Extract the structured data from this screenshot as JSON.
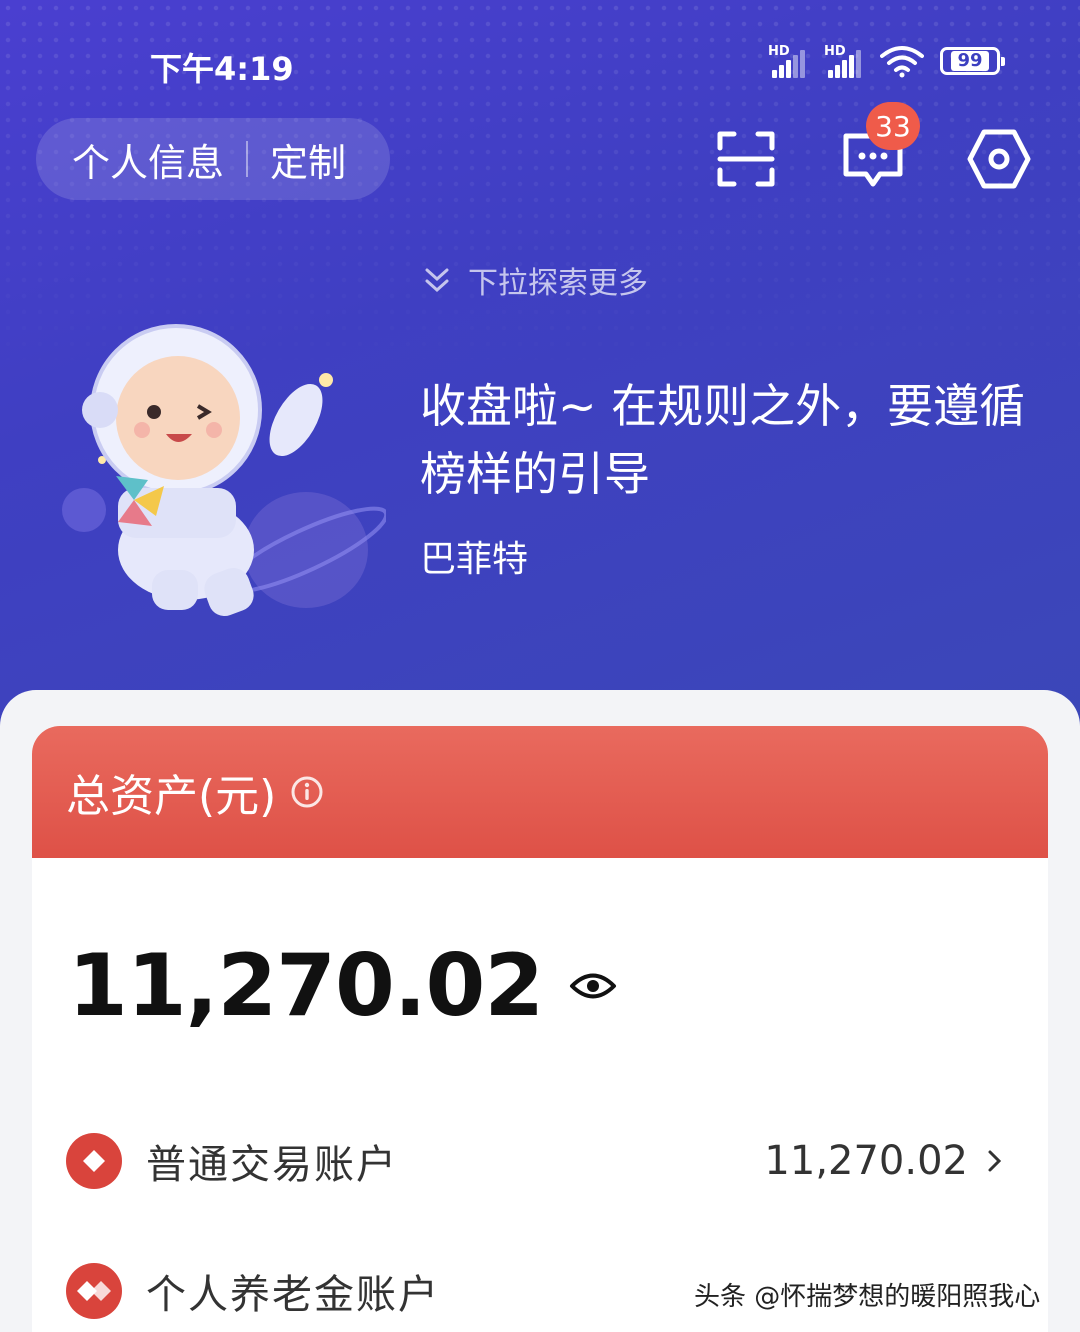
{
  "status_bar": {
    "time": "下午4:19",
    "signal1_label": "HD",
    "signal2_label": "HD",
    "battery": "99"
  },
  "header": {
    "personal_info": "个人信息",
    "customize": "定制",
    "message_badge": "33",
    "icons": [
      "scan-icon",
      "message-icon",
      "settings-icon"
    ]
  },
  "hero": {
    "pull_hint": "下拉探索更多",
    "quote": "收盘啦~ 在规则之外，要遵循榜样的引导",
    "author": "巴菲特"
  },
  "assets": {
    "title": "总资产(元)",
    "total": "11,270.02",
    "accounts": [
      {
        "name": "普通交易账户",
        "amount": "11,270.02"
      },
      {
        "name": "个人养老金账户",
        "amount": ""
      }
    ]
  },
  "watermark": "头条 @怀揣梦想的暖阳照我心",
  "colors": {
    "hero_bg": "#4140c4",
    "card_header": "#e25a4f",
    "badge": "#ef5b4a",
    "account_logo": "#d9443c"
  }
}
